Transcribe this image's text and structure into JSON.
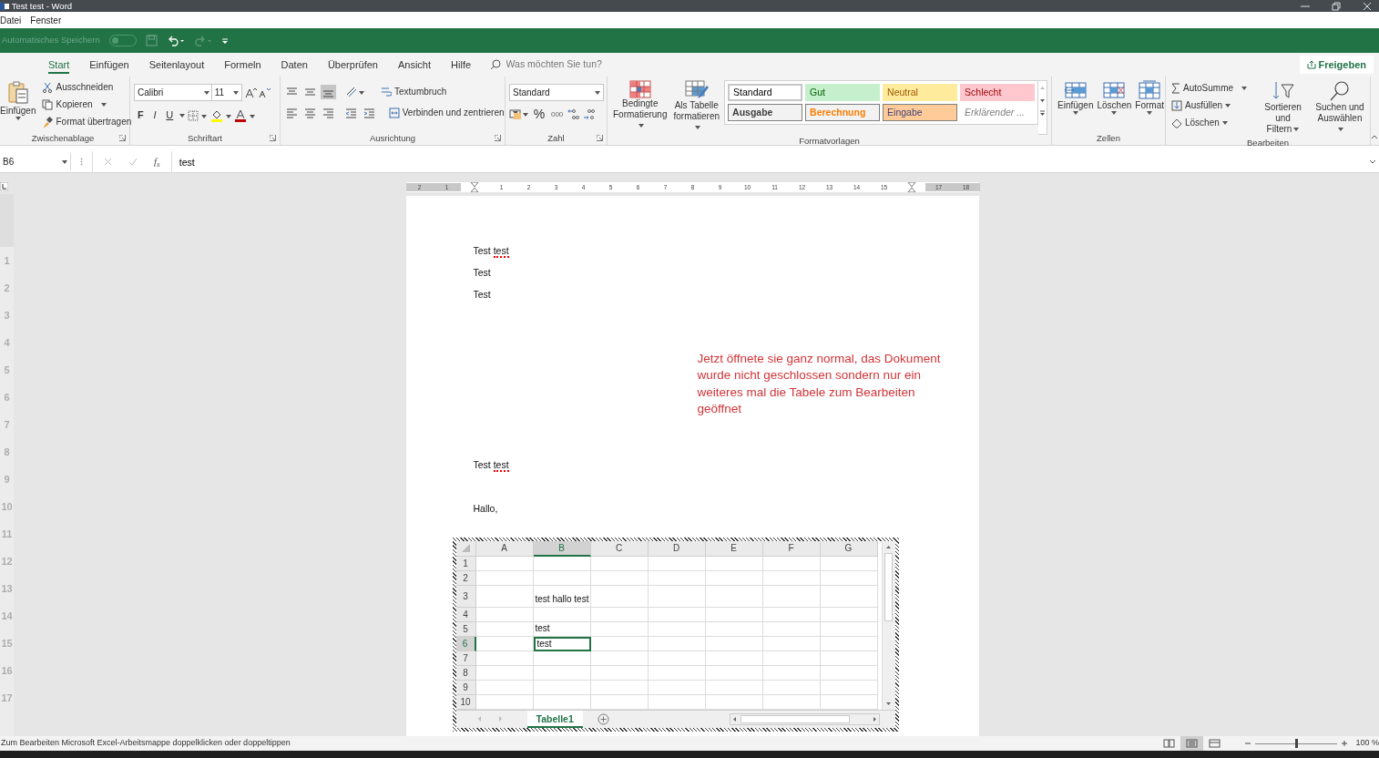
{
  "window": {
    "title": "Test test - Word"
  },
  "menu": [
    "Datei",
    "Fenster"
  ],
  "quick_access": {
    "autosave_label": "Automatisches Speichern",
    "autosave_on": false
  },
  "tabs": [
    {
      "label": "Start",
      "selected": true
    },
    {
      "label": "Einfügen",
      "selected": false
    },
    {
      "label": "Seitenlayout",
      "selected": false
    },
    {
      "label": "Formeln",
      "selected": false
    },
    {
      "label": "Daten",
      "selected": false
    },
    {
      "label": "Überprüfen",
      "selected": false
    },
    {
      "label": "Ansicht",
      "selected": false
    },
    {
      "label": "Hilfe",
      "selected": false
    }
  ],
  "tell_me": {
    "placeholder": "Was möchten Sie tun?"
  },
  "share_button": "Freigeben",
  "ribbon": {
    "clipboard": {
      "label": "Zwischenablage",
      "paste": [
        "Einfügen"
      ],
      "cut": "Ausschneiden",
      "copy": "Kopieren",
      "format_painter": "Format übertragen"
    },
    "font": {
      "label": "Schriftart",
      "font_name": "Calibri",
      "font_size": "11",
      "bold": "F",
      "italic": "I",
      "underline": "U"
    },
    "alignment": {
      "label": "Ausrichtung",
      "wrap_text": "Textumbruch",
      "merge_center": "Verbinden und zentrieren"
    },
    "number": {
      "label": "Zahl",
      "format": "Standard",
      "percent": "%",
      "thousands": "000"
    },
    "styles": {
      "label": "Formatvorlagen",
      "conditional": [
        "Bedingte",
        "Formatierung"
      ],
      "as_table": [
        "Als Tabelle",
        "formatieren"
      ],
      "gallery": [
        {
          "label": "Standard",
          "kind": "normal",
          "color": "#ffffff",
          "selected": true
        },
        {
          "label": "Gut",
          "kind": "good",
          "color": "#c6efce",
          "selected": false
        },
        {
          "label": "Neutral",
          "kind": "neutral",
          "color": "#ffeb9c",
          "selected": false
        },
        {
          "label": "Schlecht",
          "kind": "bad",
          "color": "#ffc7ce",
          "selected": false
        },
        {
          "label": "Ausgabe",
          "kind": "output",
          "color": "#f2f2f2",
          "selected": false
        },
        {
          "label": "Berechnung",
          "kind": "calculation",
          "color": "#f2f2f2",
          "selected": false
        },
        {
          "label": "Eingabe",
          "kind": "input",
          "color": "#ffcc99",
          "selected": false
        },
        {
          "label": "Erklärender ...",
          "kind": "explanatory",
          "color": "#ffffff",
          "selected": false
        }
      ]
    },
    "cells": {
      "label": "Zellen",
      "insert": [
        "Einfügen"
      ],
      "delete": [
        "Löschen"
      ],
      "format": [
        "Format"
      ]
    },
    "editing": {
      "label": "Bearbeiten",
      "autosum": "AutoSumme",
      "fill": "Ausfüllen",
      "clear": "Löschen",
      "sort": [
        "Sortieren und",
        "Filtern"
      ],
      "find": [
        "Suchen und",
        "Auswählen"
      ]
    }
  },
  "formula_bar": {
    "name_box": "B6",
    "function_label": "f$_{x}$",
    "content": "test"
  },
  "ruler": [
    {
      "kind": "number",
      "text": "2"
    },
    {
      "kind": "number",
      "text": "1"
    },
    {
      "kind": "marker"
    },
    {
      "kind": "number",
      "text": "1"
    },
    {
      "kind": "number",
      "text": "2"
    },
    {
      "kind": "number",
      "text": "3"
    },
    {
      "kind": "number",
      "text": "4"
    },
    {
      "kind": "number",
      "text": "5"
    },
    {
      "kind": "number",
      "text": "6"
    },
    {
      "kind": "number",
      "text": "7"
    },
    {
      "kind": "number",
      "text": "8"
    },
    {
      "kind": "number",
      "text": "9"
    },
    {
      "kind": "number",
      "text": "10"
    },
    {
      "kind": "number",
      "text": "11"
    },
    {
      "kind": "number",
      "text": "12"
    },
    {
      "kind": "number",
      "text": "13"
    },
    {
      "kind": "number",
      "text": "14"
    },
    {
      "kind": "number",
      "text": "15"
    },
    {
      "kind": "marker"
    },
    {
      "kind": "number",
      "text": "17"
    },
    {
      "kind": "number",
      "text": "18"
    }
  ],
  "vertical_ruler": [
    "1",
    "2",
    "3",
    "4",
    "5",
    "6",
    "7",
    "8",
    "9",
    "10",
    "11",
    "12",
    "13",
    "14",
    "15",
    "16",
    "17"
  ],
  "document": {
    "paragraphs_top": [
      {
        "words": [
          {
            "text": "Test",
            "misspelled": false
          },
          {
            "text": "test",
            "misspelled": true
          }
        ]
      },
      {
        "words": [
          {
            "text": "Test",
            "misspelled": false
          }
        ]
      },
      {
        "words": [
          {
            "text": "Test",
            "misspelled": false
          }
        ]
      }
    ],
    "note": "Jetzt öffnete sie ganz normal, das Dokument wurde nicht geschlossen sondern nur ein weiteres mal die Tabele zum Bearbeiten geöffnet",
    "paragraphs_bottom": [
      {
        "words": [
          {
            "text": "Test",
            "misspelled": false
          },
          {
            "text": "test",
            "misspelled": true
          }
        ]
      },
      {
        "words": [
          {
            "text": "Hallo,",
            "misspelled": false
          }
        ]
      }
    ],
    "embedded_sheet": {
      "columns": [
        {
          "label": "A",
          "selected": false
        },
        {
          "label": "B",
          "selected": true
        },
        {
          "label": "C",
          "selected": false
        },
        {
          "label": "D",
          "selected": false
        },
        {
          "label": "E",
          "selected": false
        },
        {
          "label": "F",
          "selected": false
        },
        {
          "label": "G",
          "selected": false
        }
      ],
      "rows": [
        {
          "label": "1",
          "selected": false,
          "tall": false,
          "cells": [
            {
              "selected": false
            },
            {
              "selected": false
            },
            {
              "selected": false
            },
            {
              "selected": false
            },
            {
              "selected": false
            },
            {
              "selected": false
            },
            {
              "selected": false
            }
          ]
        },
        {
          "label": "2",
          "selected": false,
          "tall": false,
          "cells": [
            {
              "selected": false
            },
            {
              "selected": false
            },
            {
              "selected": false
            },
            {
              "selected": false
            },
            {
              "selected": false
            },
            {
              "selected": false
            },
            {
              "selected": false
            }
          ]
        },
        {
          "label": "3",
          "selected": false,
          "tall": true,
          "cells": [
            {
              "selected": false
            },
            {
              "text": "test hallo test",
              "selected": false
            },
            {
              "selected": false
            },
            {
              "selected": false
            },
            {
              "selected": false
            },
            {
              "selected": false
            },
            {
              "selected": false
            }
          ]
        },
        {
          "label": "4",
          "selected": false,
          "tall": false,
          "cells": [
            {
              "selected": false
            },
            {
              "selected": false
            },
            {
              "selected": false
            },
            {
              "selected": false
            },
            {
              "selected": false
            },
            {
              "selected": false
            },
            {
              "selected": false
            }
          ]
        },
        {
          "label": "5",
          "selected": false,
          "tall": false,
          "cells": [
            {
              "selected": false
            },
            {
              "text": "test",
              "selected": false
            },
            {
              "selected": false
            },
            {
              "selected": false
            },
            {
              "selected": false
            },
            {
              "selected": false
            },
            {
              "selected": false
            }
          ]
        },
        {
          "label": "6",
          "selected": true,
          "tall": false,
          "cells": [
            {
              "selected": false
            },
            {
              "text": "test",
              "selected": true
            },
            {
              "selected": false
            },
            {
              "selected": false
            },
            {
              "selected": false
            },
            {
              "selected": false
            },
            {
              "selected": false
            }
          ]
        },
        {
          "label": "7",
          "selected": false,
          "tall": false,
          "cells": [
            {
              "selected": false
            },
            {
              "selected": false
            },
            {
              "selected": false
            },
            {
              "selected": false
            },
            {
              "selected": false
            },
            {
              "selected": false
            },
            {
              "selected": false
            }
          ]
        },
        {
          "label": "8",
          "selected": false,
          "tall": false,
          "cells": [
            {
              "selected": false
            },
            {
              "selected": false
            },
            {
              "selected": false
            },
            {
              "selected": false
            },
            {
              "selected": false
            },
            {
              "selected": false
            },
            {
              "selected": false
            }
          ]
        },
        {
          "label": "9",
          "selected": false,
          "tall": false,
          "cells": [
            {
              "selected": false
            },
            {
              "selected": false
            },
            {
              "selected": false
            },
            {
              "selected": false
            },
            {
              "selected": false
            },
            {
              "selected": false
            },
            {
              "selected": false
            }
          ]
        },
        {
          "label": "10",
          "selected": false,
          "tall": false,
          "cells": [
            {
              "selected": false
            },
            {
              "selected": false
            },
            {
              "selected": false
            },
            {
              "selected": false
            },
            {
              "selected": false
            },
            {
              "selected": false
            },
            {
              "selected": false
            }
          ]
        }
      ],
      "sheet_tabs": [
        {
          "label": "Tabelle1",
          "selected": true
        }
      ]
    }
  },
  "status_bar": {
    "message": "Zum Bearbeiten Microsoft Excel-Arbeitsmappe doppelklicken oder doppeltippen",
    "views": [
      {
        "selected": false
      },
      {
        "selected": true
      },
      {
        "selected": false
      }
    ],
    "zoom": {
      "level": 0.5,
      "reading": "100 %"
    }
  }
}
